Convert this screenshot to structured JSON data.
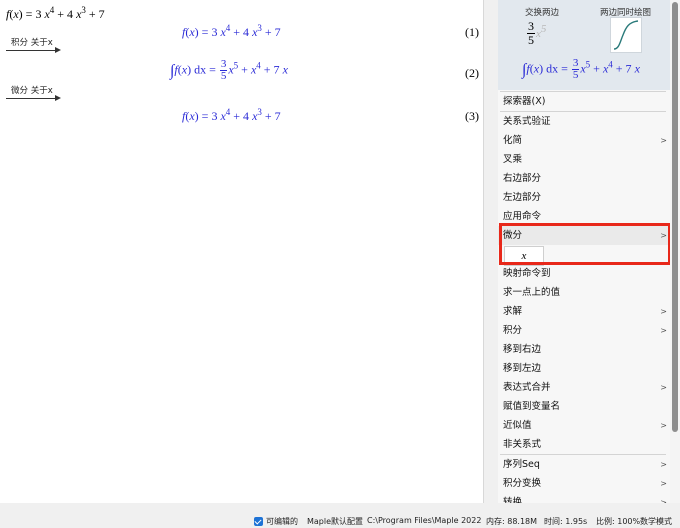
{
  "document": {
    "input": {
      "fx": "f",
      "open": "(",
      "xvar": "x",
      "close": ")",
      "eq": " = 3 ",
      "x1": "x",
      "e1": "4",
      "plus1": " + 4 ",
      "x2": "x",
      "e2": "3",
      "plus2": " + 7"
    },
    "outputs": [
      {
        "fx": "f",
        "open": "(",
        "xvar": "x",
        "close": ")",
        "eq": " = 3 ",
        "x1": "x",
        "e1": "4",
        "plus1": " + 4 ",
        "x2": "x",
        "e2": "3",
        "plus2": " + 7",
        "number": "(1)"
      },
      {
        "integral": "∫",
        "fx": "f",
        "open": "(",
        "xvar": "x",
        "close": ")",
        "dx": " dx",
        "eq": " = ",
        "num": "3",
        "den": "5",
        "x1": "x",
        "e1": "5",
        "plus1": " + ",
        "x2": "x",
        "e2": "4",
        "plus2": " + 7 ",
        "x3": "x",
        "number": "(2)"
      },
      {
        "fx": "f",
        "open": "(",
        "xvar": "x",
        "close": ")",
        "eq": " = 3 ",
        "x1": "x",
        "e1": "4",
        "plus1": " + 4 ",
        "x2": "x",
        "e2": "3",
        "plus2": " + 7",
        "number": "(3)"
      }
    ],
    "arrows": [
      {
        "label": "积分 关于x"
      },
      {
        "label": "微分 关于x"
      }
    ]
  },
  "preview": {
    "swap_title": "交换两边",
    "plot_title": "两边同时绘图",
    "frac_num": "3",
    "frac_den": "5",
    "faint_x": "x",
    "faint_exp": "5",
    "int": {
      "integral": "∫",
      "fx": "f",
      "open": "(",
      "xvar": "x",
      "close": ")",
      "dx": " dx",
      "eq": " = ",
      "num": "3",
      "den": "5",
      "x1": "x",
      "e1": "5",
      "plus1": " + ",
      "x2": "x",
      "e2": "4",
      "plus2": " + 7 ",
      "x3": "x"
    }
  },
  "menu": {
    "items": [
      {
        "label": "探索器(X)"
      },
      {
        "label": "关系式验证"
      },
      {
        "label": "化简",
        "submenu": ">"
      },
      {
        "label": "叉乘"
      },
      {
        "label": "右边部分"
      },
      {
        "label": "左边部分"
      },
      {
        "label": "应用命令"
      },
      {
        "label": "微分",
        "submenu": ">"
      },
      {
        "label": "映射命令到"
      },
      {
        "label": "求一点上的值"
      },
      {
        "label": "求解",
        "submenu": ">"
      },
      {
        "label": "积分",
        "submenu": ">"
      },
      {
        "label": "移到右边"
      },
      {
        "label": "移到左边"
      },
      {
        "label": "表达式合并",
        "submenu": ">"
      },
      {
        "label": "赋值到变量名"
      },
      {
        "label": "近似值",
        "submenu": ">"
      },
      {
        "label": "非关系式"
      },
      {
        "label": "序列Seq",
        "submenu": ">"
      },
      {
        "label": "积分变换",
        "submenu": ">"
      },
      {
        "label": "转换",
        "submenu": ">"
      }
    ],
    "differentiate_option": "x"
  },
  "status": {
    "editable": "可编辑的",
    "config": "Maple默认配置",
    "path": "C:\\Program Files\\Maple 2022",
    "memory": "内存: 88.18M",
    "time": "时间: 1.95s",
    "zoom": "比例: 100%",
    "mode": "数学模式"
  },
  "colors": {
    "output": "#2a2ad6",
    "highlight": "#e8281a",
    "checkbox": "#1e73d6"
  }
}
